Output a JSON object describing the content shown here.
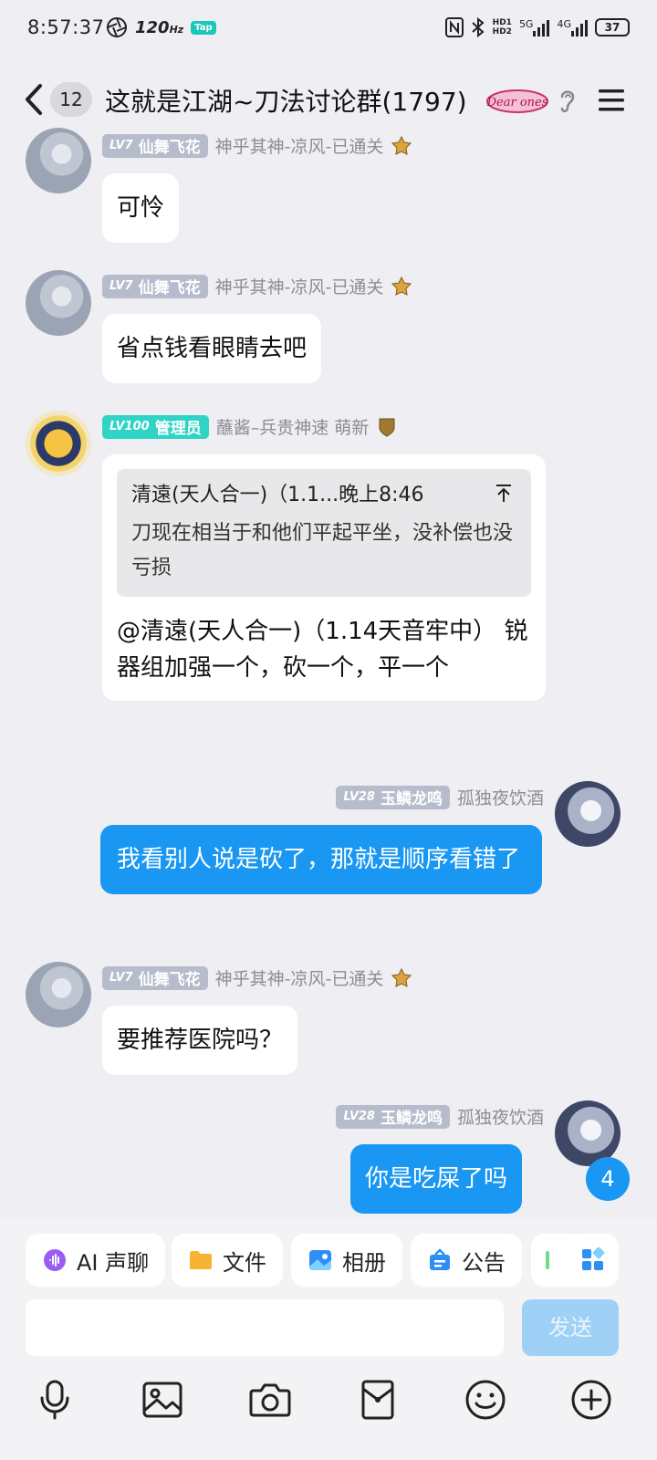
{
  "status_bar": {
    "time": "8:57:37",
    "refresh_rate": "120",
    "refresh_unit": "Hz",
    "tap_label": "Tap",
    "network_5g": "5G",
    "network_4g": "4G",
    "hd1": "HD1",
    "hd2": "HD2",
    "battery": "37"
  },
  "header": {
    "unread_count": "12",
    "title": "这就是江湖~刀法讨论群(1797)",
    "badge_text": "Dear ones"
  },
  "messages": [
    {
      "level": "LV7",
      "title": "仙舞飞花",
      "nickname": "神乎其神-凉风-已通关",
      "text": "可怜"
    },
    {
      "level": "LV7",
      "title": "仙舞飞花",
      "nickname": "神乎其神-凉风-已通关",
      "text": "省点钱看眼睛去吧"
    },
    {
      "level": "LV100",
      "title": "管理员",
      "nickname": "蘸酱–兵贵神速 萌新",
      "quote_header": "清遠(天人合一)（1.1...晚上8:46",
      "quote_body": "刀现在相当于和他们平起平坐，没补偿也没亏损",
      "text": "@清遠(天人合一)（1.14天音牢中） 锐器组加强一个，砍一个，平一个"
    },
    {
      "level": "LV28",
      "title": "玉鳞龙鸣",
      "nickname": "孤独夜饮酒",
      "text": "我看别人说是砍了，那就是顺序看错了"
    },
    {
      "level": "LV7",
      "title": "仙舞飞花",
      "nickname": "神乎其神-凉风-已通关",
      "text": "要推荐医院吗？"
    },
    {
      "level": "LV28",
      "title": "玉鳞龙鸣",
      "nickname": "孤独夜饮酒",
      "text": "你是吃屎了吗"
    }
  ],
  "new_message_badge": "4",
  "quick_actions": [
    {
      "label": "AI 声聊",
      "icon": "ai-voice-icon"
    },
    {
      "label": "文件",
      "icon": "folder-icon"
    },
    {
      "label": "相册",
      "icon": "album-icon"
    },
    {
      "label": "公告",
      "icon": "announcement-icon"
    }
  ],
  "input": {
    "value": "",
    "placeholder": "",
    "send_label": "发送"
  },
  "toolbar_icons": [
    "microphone-icon",
    "image-icon",
    "camera-icon",
    "red-packet-icon",
    "emoji-icon",
    "plus-icon"
  ],
  "colors": {
    "accent_blue": "#1997f2",
    "background": "#eeeef3",
    "admin_teal": "#2fd4c5",
    "level_grey": "#b6bccb"
  }
}
